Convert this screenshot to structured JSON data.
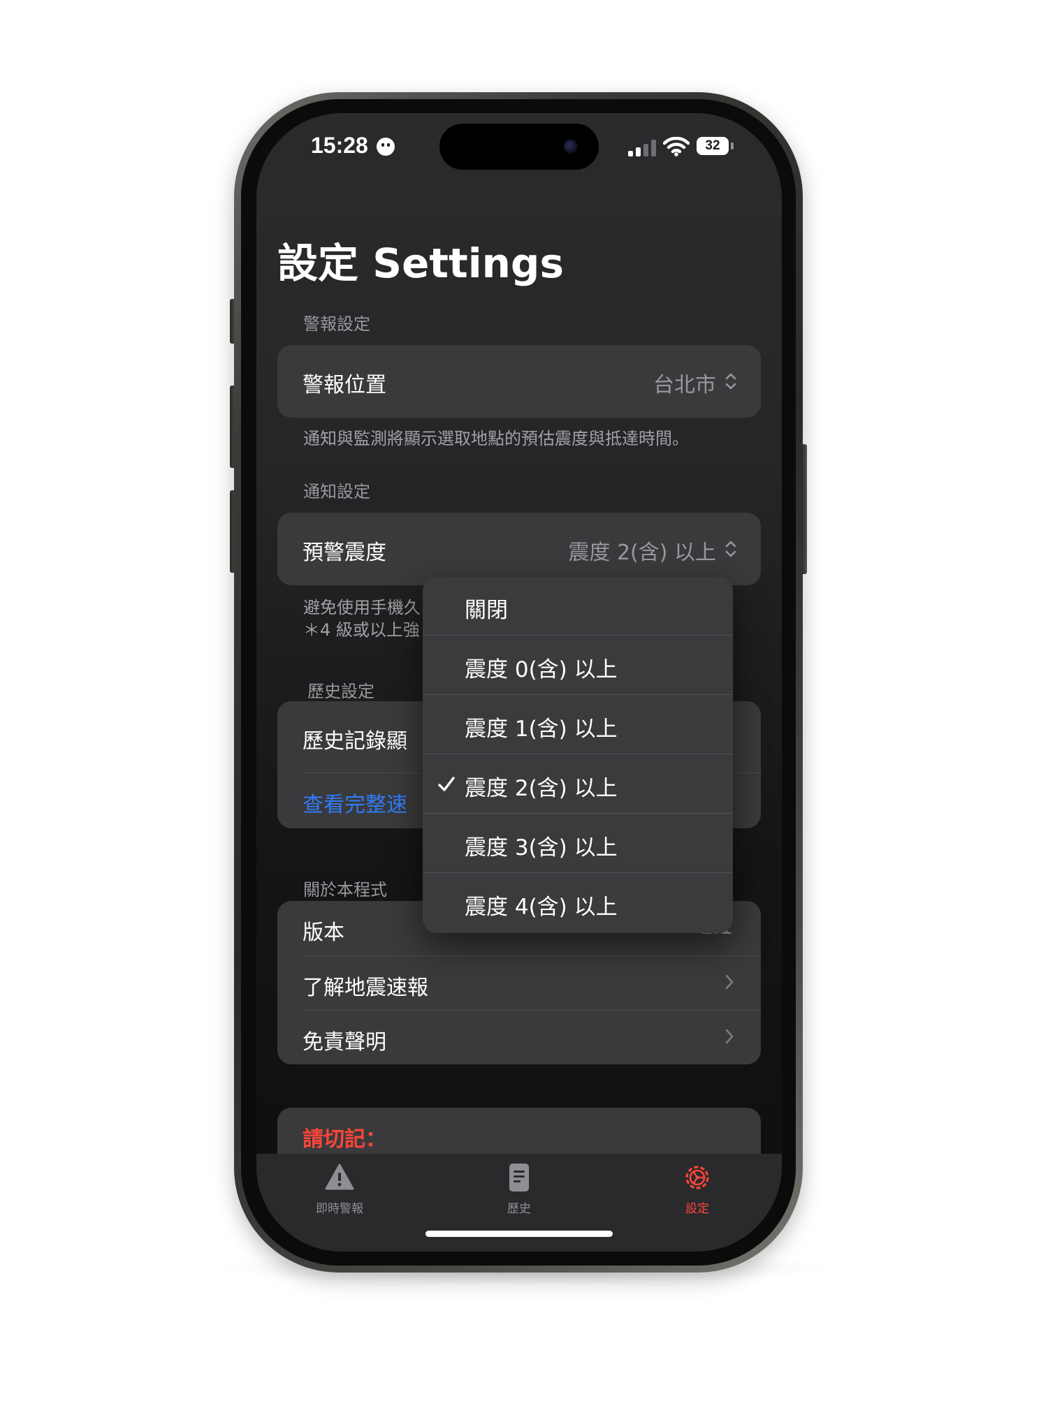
{
  "status_bar": {
    "time": "15:28",
    "battery": "32"
  },
  "page_title": "設定 Settings",
  "alert_section": {
    "header": "警報設定",
    "location_label": "警報位置",
    "location_value": "台北市",
    "footer": "通知與監測將顯示選取地點的預估震度與抵達時間。"
  },
  "notify_section": {
    "header": "通知設定",
    "intensity_label": "預警震度",
    "intensity_value": "震度 2(含) 以上",
    "footer_line1": "避免使用手機久",
    "footer_line2": "＊4 級或以上強"
  },
  "history_section": {
    "header": "歷史設定",
    "display_label": "歷史記錄顯",
    "full_link": "查看完整速"
  },
  "about_section": {
    "header": "關於本程式",
    "version_label": "版本",
    "version_value": "1.1",
    "learn_label": "了解地震速報",
    "disclaimer_label": "免責聲明"
  },
  "reminder": {
    "title": "請切記："
  },
  "dropdown": {
    "options": [
      {
        "label": "關閉",
        "checked": false
      },
      {
        "label": "震度 0(含) 以上",
        "checked": false
      },
      {
        "label": "震度 1(含) 以上",
        "checked": false
      },
      {
        "label": "震度 2(含) 以上",
        "checked": true
      },
      {
        "label": "震度 3(含) 以上",
        "checked": false
      },
      {
        "label": "震度 4(含) 以上",
        "checked": false
      }
    ]
  },
  "tabbar": {
    "tabs": [
      {
        "label": "即時警報",
        "icon": "warning-icon",
        "active": false
      },
      {
        "label": "歷史",
        "icon": "document-icon",
        "active": false
      },
      {
        "label": "設定",
        "icon": "gear-icon",
        "active": true
      }
    ]
  },
  "colors": {
    "accent": "#ff453a",
    "link": "#2f7cf6",
    "inactive": "#8e8e93",
    "card": "#3a3a3c"
  }
}
